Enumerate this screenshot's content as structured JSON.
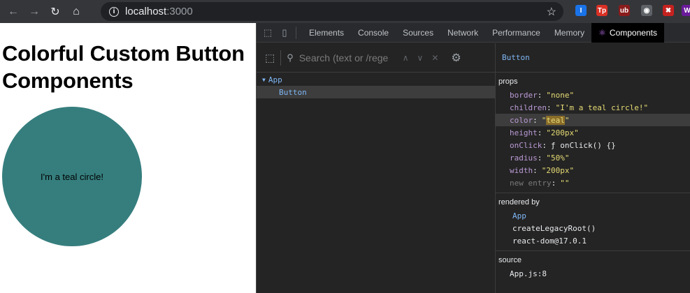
{
  "browser": {
    "url_host": "localhost",
    "url_port": ":3000",
    "nav": {
      "back": "←",
      "forward": "→",
      "reload": "↻",
      "home": "⌂"
    },
    "bookmark_icon": "star-icon",
    "extensions": [
      {
        "name": "ext-blue-icon",
        "glyph": "I",
        "color": "#1a73e8"
      },
      {
        "name": "ext-tp-icon",
        "glyph": "Tp",
        "color": "#d93025"
      },
      {
        "name": "ext-ublock-icon",
        "glyph": "ub",
        "color": "#8a1c1c"
      },
      {
        "name": "ext-shield-icon",
        "glyph": "◉",
        "color": "#5f6368"
      },
      {
        "name": "ext-red-icon",
        "glyph": "✖",
        "color": "#c5221f"
      },
      {
        "name": "ext-purple-icon",
        "glyph": "W",
        "color": "#6a1b9a"
      }
    ]
  },
  "page": {
    "title": "Colorful Custom Button Components",
    "button_text": "I'm a teal circle!",
    "button_color": "#367e7e"
  },
  "devtools": {
    "tabs": [
      "Elements",
      "Console",
      "Sources",
      "Network",
      "Performance",
      "Memory",
      "Components"
    ],
    "selected_tab": "Components",
    "search_placeholder": "Search (text or /rege",
    "tree": [
      {
        "label": "App",
        "depth": 0,
        "expanded": true
      },
      {
        "label": "Button",
        "depth": 1,
        "selected": true
      }
    ],
    "selected_component": "Button",
    "props_title": "props",
    "props": [
      {
        "key": "border",
        "value": "\"none\""
      },
      {
        "key": "children",
        "value": "\"I'm a teal circle!\""
      },
      {
        "key": "color",
        "value_pre": "\"",
        "value_mark": "teal",
        "value_post": "\""
      },
      {
        "key": "height",
        "value": "\"200px\""
      },
      {
        "key": "onClick",
        "value": "ƒ onClick() {}"
      },
      {
        "key": "radius",
        "value": "\"50%\""
      },
      {
        "key": "width",
        "value": "\"200px\""
      },
      {
        "key": "new entry",
        "value": "\"\""
      }
    ],
    "rendered_by_title": "rendered by",
    "rendered_by": [
      "App",
      "createLegacyRoot()",
      "react-dom@17.0.1"
    ],
    "source_title": "source",
    "source": "App.js:8"
  }
}
